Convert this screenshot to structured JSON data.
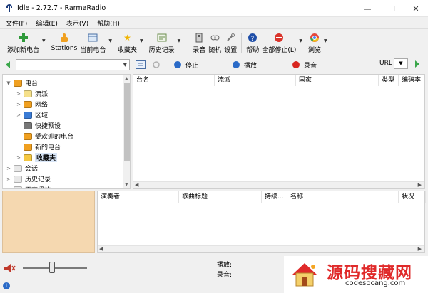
{
  "window": {
    "title": "Idle - 2.72.7 - RarmaRadio",
    "minimize": "—",
    "maximize": "☐",
    "close": "✕"
  },
  "menu": [
    "文件(F)",
    "编辑(E)",
    "表示(V)",
    "帮助(H)"
  ],
  "toolbar": {
    "add_station": "添加新电台",
    "stations": "Stations",
    "current_station": "当前电台",
    "favorites": "收藏夹",
    "history": "历史记录",
    "record": "录音",
    "random": "随机",
    "settings": "设置",
    "help": "帮助",
    "stop_all": "全部停止(L)",
    "browse": "浏览"
  },
  "addressbar": {
    "stop": "停止",
    "play": "播放",
    "record": "录音",
    "url_label": "URL"
  },
  "tree": [
    {
      "label": "电台",
      "level": 0,
      "expanded": true,
      "icon_color": "#f0a020"
    },
    {
      "label": "流派",
      "level": 1,
      "expanded": false,
      "icon_color": "#f5e08a"
    },
    {
      "label": "网络",
      "level": 1,
      "expanded": false,
      "icon_color": "#f0a020"
    },
    {
      "label": "区域",
      "level": 1,
      "expanded": false,
      "icon_color": "#3a7bd5"
    },
    {
      "label": "快捷预设",
      "level": 1,
      "expanded": null,
      "icon_color": "#777777"
    },
    {
      "label": "受欢迎的电台",
      "level": 1,
      "expanded": null,
      "icon_color": "#f0a020"
    },
    {
      "label": "新的电台",
      "level": 1,
      "expanded": null,
      "icon_color": "#f0a020"
    },
    {
      "label": "收藏夹",
      "level": 1,
      "expanded": false,
      "icon_color": "#f5c842",
      "selected": true
    },
    {
      "label": "会话",
      "level": 0,
      "expanded": false,
      "icon_color": "#e8e8e8"
    },
    {
      "label": "历史记录",
      "level": 0,
      "expanded": false,
      "icon_color": "#e8e8e8"
    },
    {
      "label": "正在播放",
      "level": 0,
      "expanded": false,
      "icon_color": "#e8e8e8"
    }
  ],
  "station_columns": [
    "台名",
    "流派",
    "国家",
    "类型",
    "编码率"
  ],
  "track_columns": [
    "演奏者",
    "歌曲标题",
    "持续...",
    "名称",
    "状况"
  ],
  "status": {
    "playing_label": "播放:",
    "recording_label": "录音:",
    "volume": 0.45
  },
  "watermark": {
    "title": "源码搜藏网",
    "url": "codesocang.com"
  },
  "colors": {
    "accent": "#3aa64a",
    "panel_tan": "#f5d8b0",
    "watermark_red": "#e02a2a"
  }
}
